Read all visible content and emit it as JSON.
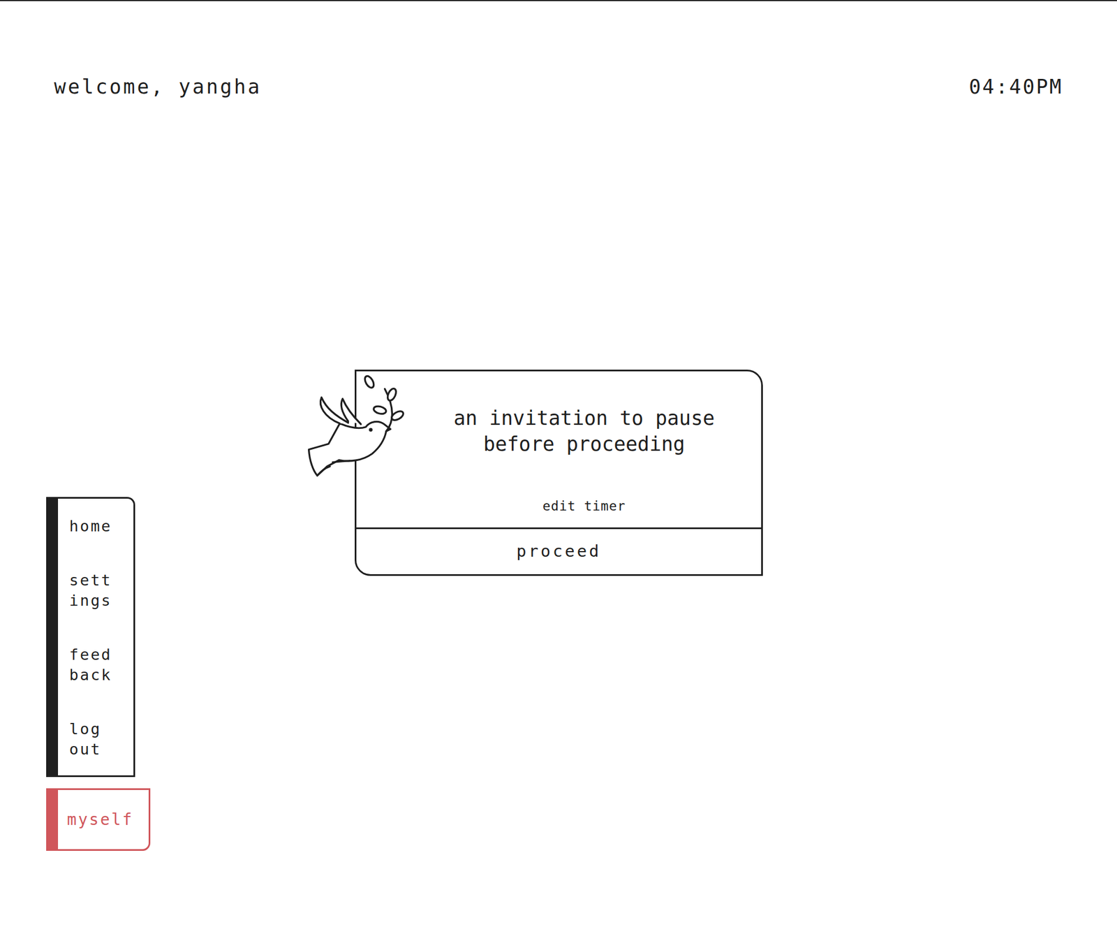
{
  "header": {
    "greeting": "welcome, yangha",
    "time": "04:40PM"
  },
  "card": {
    "message_lines": [
      "an invitation to pause",
      "before proceeding"
    ],
    "edit_link": "edit timer",
    "button": "proceed"
  },
  "sidebar": {
    "items": [
      {
        "lines": [
          "home"
        ]
      },
      {
        "lines": [
          "sett",
          "ings"
        ]
      },
      {
        "lines": [
          "feed",
          "back"
        ]
      },
      {
        "lines": [
          "log",
          "out"
        ]
      }
    ]
  },
  "profile_button": "myself"
}
